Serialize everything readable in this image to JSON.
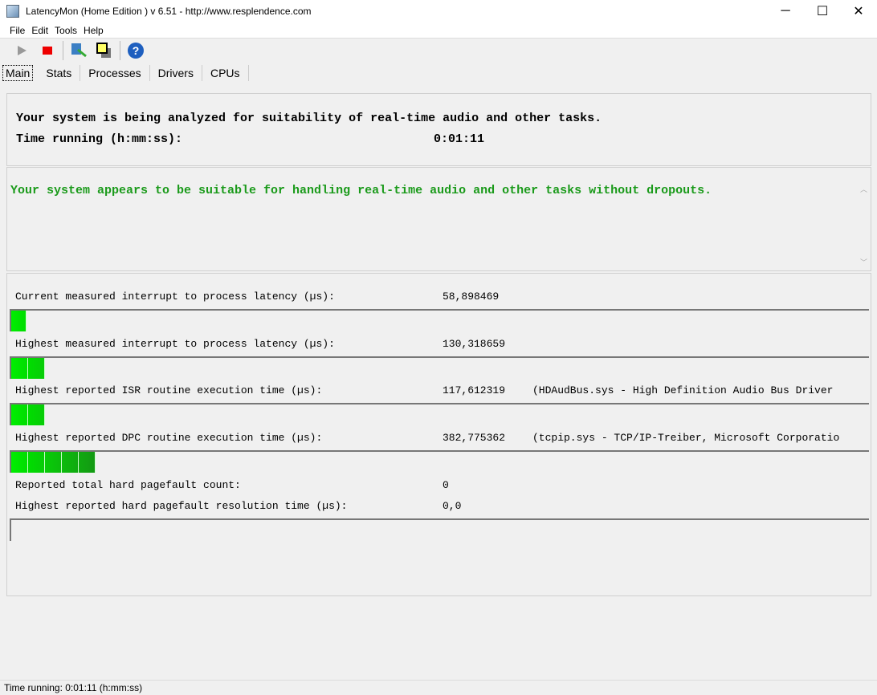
{
  "window": {
    "title": "LatencyMon  (Home Edition )  v 6.51 - http://www.resplendence.com",
    "minimize": "─",
    "maximize": "☐",
    "close": "✕"
  },
  "menu": [
    "File",
    "Edit",
    "Tools",
    "Help"
  ],
  "toolbar": [
    "play-icon",
    "stop-icon",
    "driver-search-icon",
    "windows-icon",
    "help-icon"
  ],
  "tabs": [
    "Main",
    "Stats",
    "Processes",
    "Drivers",
    "CPUs"
  ],
  "header": {
    "line1": "Your system is being analyzed for suitability of real-time audio and other tasks.",
    "time_label": "Time running (h:mm:ss):",
    "time_value": "0:01:11"
  },
  "verdict": {
    "text": "Your system appears to be suitable for handling real-time audio and other tasks without dropouts.",
    "color": "#1a9a1a"
  },
  "metrics": [
    {
      "label": "Current measured interrupt to process latency (µs):",
      "value": "58,898469",
      "detail": "",
      "fill": 0.018
    },
    {
      "label": "Highest measured interrupt to process latency (µs):",
      "value": "130,318659",
      "detail": "",
      "fill": 0.038
    },
    {
      "label": "Highest reported ISR routine execution time (µs):",
      "value": "117,612319",
      "detail": "(HDAudBus.sys - High Definition Audio Bus Driver",
      "fill": 0.039
    },
    {
      "label": "Highest reported DPC routine execution time (µs):",
      "value": "382,775362",
      "detail": "(tcpip.sys - TCP/IP-Treiber, Microsoft Corporatio",
      "fill": 0.1
    }
  ],
  "pagefault": {
    "count_label": "Reported total hard pagefault count:",
    "count_value": "0",
    "time_label": "Highest reported hard pagefault resolution time (µs):",
    "time_value": "0,0",
    "fill": 0
  },
  "status": "Time running: 0:01:11  (h:mm:ss)"
}
